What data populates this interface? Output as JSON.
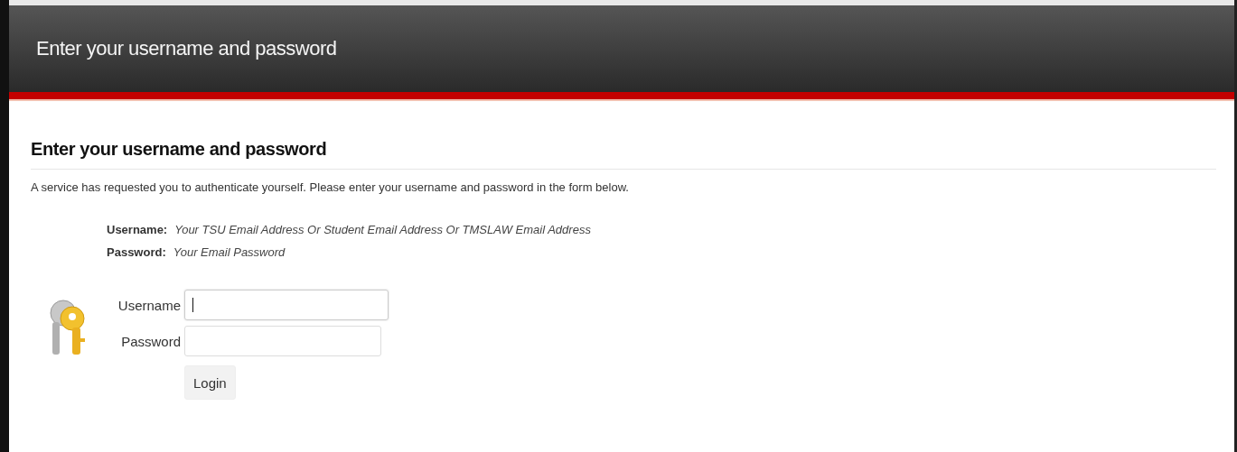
{
  "header": {
    "title": "Enter your username and password"
  },
  "heading": "Enter your username and password",
  "intro": "A service has requested you to authenticate yourself. Please enter your username and password in the form below.",
  "hints": [
    {
      "label": "Username:",
      "text": "Your TSU Email Address Or Student Email Address Or TMSLAW Email Address"
    },
    {
      "label": "Password:",
      "text": "Your Email Password"
    }
  ],
  "fields": [
    {
      "label": "Username",
      "focused": true
    },
    {
      "label": "Password",
      "focused": false
    }
  ],
  "button": "Login"
}
